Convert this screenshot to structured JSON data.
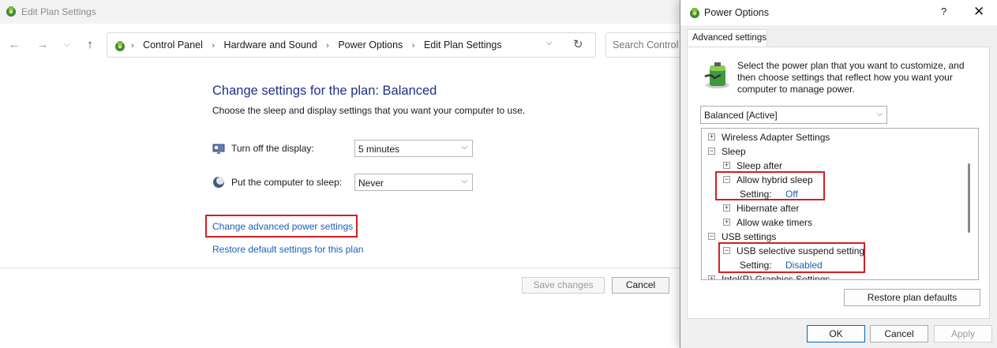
{
  "main_window": {
    "title": "Edit Plan Settings",
    "breadcrumbs": [
      "Control Panel",
      "Hardware and Sound",
      "Power Options",
      "Edit Plan Settings"
    ],
    "search_placeholder": "Search Control P",
    "heading": "Change settings for the plan: Balanced",
    "subheading": "Choose the sleep and display settings that you want your computer to use.",
    "display_label": "Turn off the display:",
    "display_value": "5 minutes",
    "sleep_label": "Put the computer to sleep:",
    "sleep_value": "Never",
    "advanced_link": "Change advanced power settings",
    "restore_link": "Restore default settings for this plan",
    "save_button": "Save changes",
    "cancel_button": "Cancel"
  },
  "dialog": {
    "title": "Power Options",
    "help_glyph": "?",
    "close_glyph": "✕",
    "tab": "Advanced settings",
    "description": "Select the power plan that you want to customize, and then choose settings that reflect how you want your computer to manage power.",
    "plan_select": "Balanced [Active]",
    "tree": {
      "wireless": "Wireless Adapter Settings",
      "sleep": "Sleep",
      "sleep_after": "Sleep after",
      "hybrid_sleep": "Allow hybrid sleep",
      "setting_label": "Setting:",
      "hybrid_value": "Off",
      "hibernate_after": "Hibernate after",
      "wake_timers": "Allow wake timers",
      "usb": "USB settings",
      "usb_suspend": "USB selective suspend setting",
      "usb_value": "Disabled",
      "graphics": "Intel(R) Graphics Settings"
    },
    "restore_button": "Restore plan defaults",
    "ok_button": "OK",
    "cancel_button": "Cancel",
    "apply_button": "Apply"
  },
  "colors": {
    "accent_link": "#1a5fb4",
    "heading": "#1e3287",
    "highlight": "#d21f26"
  },
  "icons": [
    "power-options-icon",
    "back-arrow-icon",
    "forward-arrow-icon",
    "recent-dropdown-icon",
    "up-arrow-icon",
    "chevron-right-icon",
    "refresh-icon",
    "display-icon",
    "moon-icon",
    "battery-plug-icon",
    "expand-icon",
    "collapse-icon"
  ]
}
